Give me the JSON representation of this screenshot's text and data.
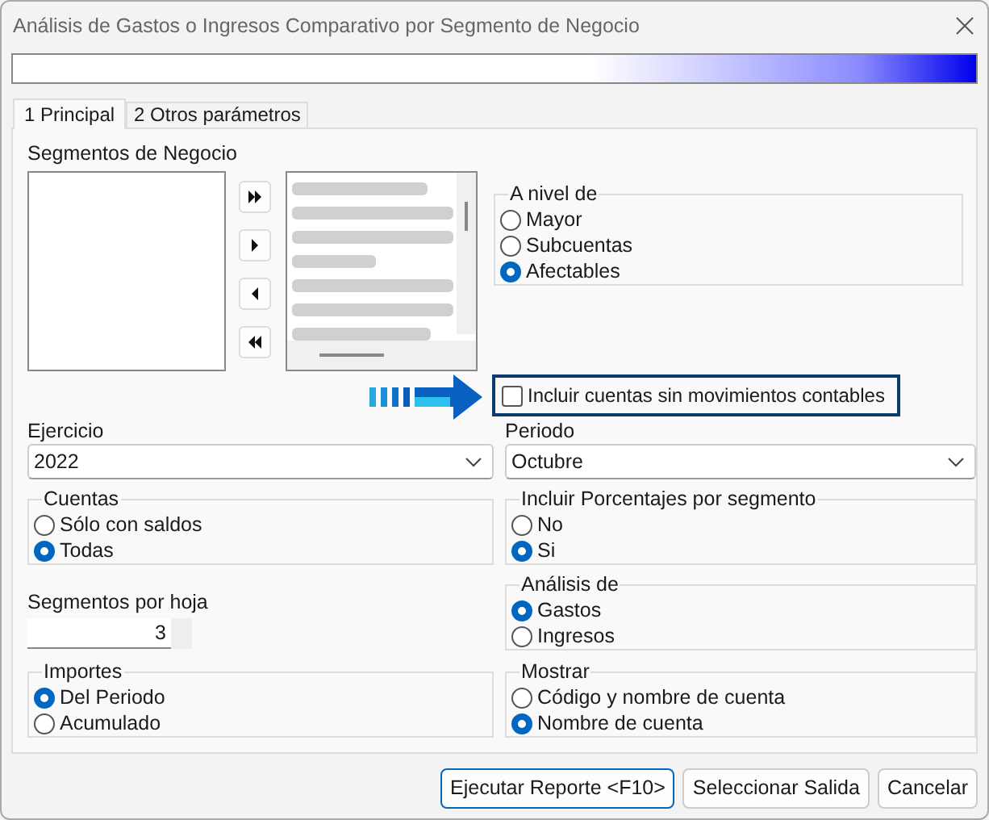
{
  "window": {
    "title": "Análisis de Gastos o Ingresos Comparativo por Segmento de Negocio"
  },
  "tabs": [
    {
      "label": "1 Principal",
      "selected": true
    },
    {
      "label": "2 Otros parámetros",
      "selected": false
    }
  ],
  "segments": {
    "label": "Segmentos de Negocio"
  },
  "nivel": {
    "title": "A nivel de",
    "options": [
      {
        "label": "Mayor",
        "selected": false
      },
      {
        "label": "Subcuentas",
        "selected": false
      },
      {
        "label": "Afectables",
        "selected": true
      }
    ]
  },
  "include_without_movements": {
    "label": "Incluir cuentas sin movimientos contables",
    "checked": false
  },
  "ejercicio": {
    "label": "Ejercicio",
    "value": "2022"
  },
  "periodo": {
    "label": "Periodo",
    "value": "Octubre"
  },
  "cuentas": {
    "title": "Cuentas",
    "options": [
      {
        "label": "Sólo con saldos",
        "selected": false
      },
      {
        "label": "Todas",
        "selected": true
      }
    ]
  },
  "porcentajes": {
    "title": "Incluir Porcentajes por segmento",
    "options": [
      {
        "label": "No",
        "selected": false
      },
      {
        "label": "Si",
        "selected": true
      }
    ]
  },
  "segmentos_por_hoja": {
    "label": "Segmentos por hoja",
    "value": "3"
  },
  "analisis": {
    "title": "Análisis de",
    "options": [
      {
        "label": "Gastos",
        "selected": true
      },
      {
        "label": "Ingresos",
        "selected": false
      }
    ]
  },
  "importes": {
    "title": "Importes",
    "options": [
      {
        "label": "Del Periodo",
        "selected": true
      },
      {
        "label": "Acumulado",
        "selected": false
      }
    ]
  },
  "mostrar": {
    "title": "Mostrar",
    "options": [
      {
        "label": "Código y nombre de cuenta",
        "selected": false
      },
      {
        "label": "Nombre de cuenta",
        "selected": true
      }
    ]
  },
  "buttons": [
    {
      "label": "Ejecutar Reporte <F10>",
      "default": true
    },
    {
      "label": "Seleccionar Salida",
      "default": false
    },
    {
      "label": "Cancelar",
      "default": false
    }
  ]
}
